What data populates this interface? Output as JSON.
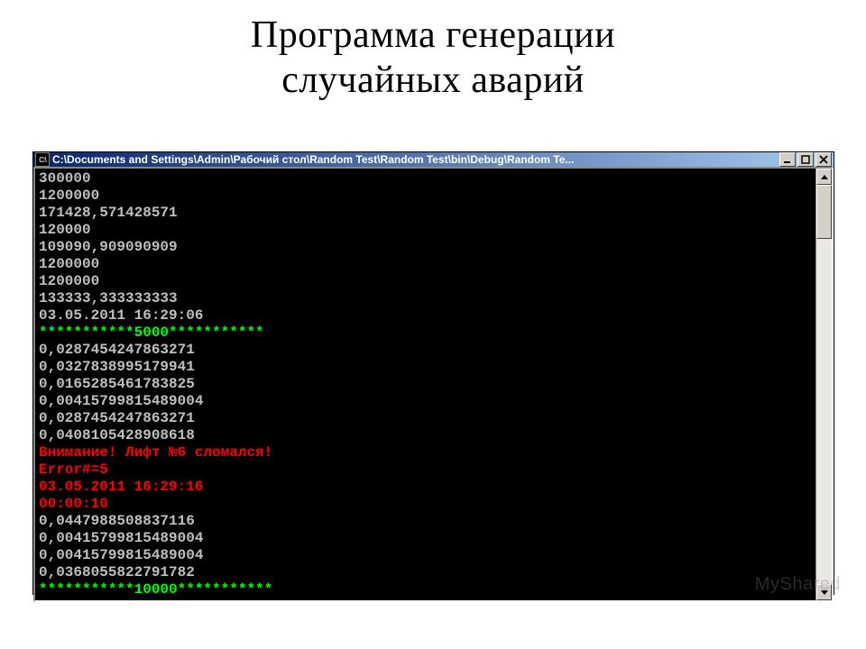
{
  "page": {
    "title_line1": "Программа генерации",
    "title_line2": "случайных аварий"
  },
  "window": {
    "icon_text": "C:\\",
    "title": "C:\\Documents and Settings\\Admin\\Рабочий стол\\Random Test\\Random Test\\bin\\Debug\\Random Te..."
  },
  "console": {
    "lines": [
      {
        "text": "300000",
        "color": "white"
      },
      {
        "text": "1200000",
        "color": "white"
      },
      {
        "text": "171428,571428571",
        "color": "white"
      },
      {
        "text": "120000",
        "color": "white"
      },
      {
        "text": "109090,909090909",
        "color": "white"
      },
      {
        "text": "1200000",
        "color": "white"
      },
      {
        "text": "1200000",
        "color": "white"
      },
      {
        "text": "133333,333333333",
        "color": "white"
      },
      {
        "text": "03.05.2011 16:29:06",
        "color": "white"
      },
      {
        "text": "***********5000***********",
        "color": "green"
      },
      {
        "text": "0,0287454247863271",
        "color": "white"
      },
      {
        "text": "0,0327838995179941",
        "color": "white"
      },
      {
        "text": "0,0165285461783825",
        "color": "white"
      },
      {
        "text": "0,00415799815489004",
        "color": "white"
      },
      {
        "text": "0,0287454247863271",
        "color": "white"
      },
      {
        "text": "0,0408105428908618",
        "color": "white"
      },
      {
        "text": "Внимание! Лифт №6 сломался!",
        "color": "red"
      },
      {
        "text": "Error#=5",
        "color": "red"
      },
      {
        "text": "03.05.2011 16:29:16",
        "color": "red"
      },
      {
        "text": "00:00:10",
        "color": "red"
      },
      {
        "text": "0,0447988508837116",
        "color": "white"
      },
      {
        "text": "0,00415799815489004",
        "color": "white"
      },
      {
        "text": "0,00415799815489004",
        "color": "white"
      },
      {
        "text": "0,0368055822791782",
        "color": "white"
      },
      {
        "text": "***********10000***********",
        "color": "green"
      }
    ]
  },
  "watermark": "MyShared"
}
